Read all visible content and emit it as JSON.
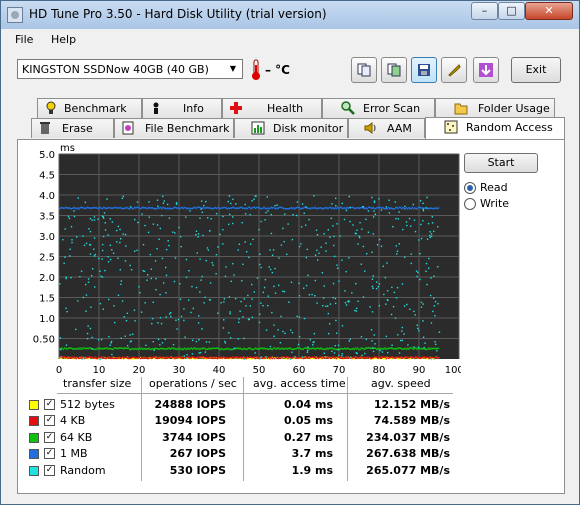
{
  "window": {
    "title": "HD Tune Pro 3.50 - Hard Disk Utility (trial version)",
    "controls": {
      "minimize": "–",
      "maximize": "□",
      "close": "✕"
    }
  },
  "menu": {
    "file": "File",
    "help": "Help"
  },
  "toolbar": {
    "drive_select": "KINGSTON SSDNow 40GB (40 GB)",
    "temperature": "– °C",
    "exit_label": "Exit"
  },
  "tabs_row1": [
    {
      "label": "Benchmark",
      "icon": "benchmark-icon"
    },
    {
      "label": "Info",
      "icon": "info-icon"
    },
    {
      "label": "Health",
      "icon": "health-icon"
    },
    {
      "label": "Error Scan",
      "icon": "search-icon"
    },
    {
      "label": "Folder Usage",
      "icon": "folder-icon"
    }
  ],
  "tabs_row2": [
    {
      "label": "Erase",
      "icon": "trash-icon"
    },
    {
      "label": "File Benchmark",
      "icon": "file-benchmark-icon"
    },
    {
      "label": "Disk monitor",
      "icon": "monitor-icon"
    },
    {
      "label": "AAM",
      "icon": "speaker-icon"
    },
    {
      "label": "Random Access",
      "icon": "random-access-icon"
    }
  ],
  "controls": {
    "start_label": "Start",
    "read_label": "Read",
    "write_label": "Write",
    "selected": "Read"
  },
  "table": {
    "headers": [
      "transfer size",
      "operations / sec",
      "avg. access time",
      "agv. speed"
    ],
    "rows": [
      {
        "label": "512 bytes",
        "color": "#ffff00",
        "checked": true,
        "ops": "24888 IOPS",
        "access": "0.04 ms",
        "speed": "12.152 MB/s"
      },
      {
        "label": "4 KB",
        "color": "#e01010",
        "checked": true,
        "ops": "19094 IOPS",
        "access": "0.05 ms",
        "speed": "74.589 MB/s"
      },
      {
        "label": "64 KB",
        "color": "#10c010",
        "checked": true,
        "ops": "3744 IOPS",
        "access": "0.27 ms",
        "speed": "234.037 MB/s"
      },
      {
        "label": "1 MB",
        "color": "#2070e0",
        "checked": true,
        "ops": "267 IOPS",
        "access": "3.7 ms",
        "speed": "267.638 MB/s"
      },
      {
        "label": "Random",
        "color": "#20e0e0",
        "checked": true,
        "ops": "530 IOPS",
        "access": "1.9 ms",
        "speed": "265.077 MB/s"
      }
    ]
  },
  "chart_data": {
    "type": "scatter",
    "ylabel": "ms",
    "xlabel": "",
    "ylim": [
      0,
      5.0
    ],
    "xlim": [
      0,
      100
    ],
    "y_ticks": [
      "5.0",
      "4.5",
      "4.0",
      "3.5",
      "3.0",
      "2.5",
      "2.0",
      "1.5",
      "1.0",
      "0.50"
    ],
    "x_ticks": [
      "0",
      "10",
      "20",
      "30",
      "40",
      "50",
      "60",
      "70",
      "80",
      "90",
      "100%"
    ],
    "grid": true,
    "series": [
      {
        "name": "512 bytes",
        "color": "#ffff00",
        "mean_y": 0.04
      },
      {
        "name": "4 KB",
        "color": "#e01010",
        "mean_y": 0.05
      },
      {
        "name": "64 KB",
        "color": "#10c010",
        "mean_y": 0.27
      },
      {
        "name": "1 MB",
        "color": "#2070e0",
        "mean_y": 3.7
      },
      {
        "name": "Random",
        "color": "#20e0e0",
        "mean_y": 1.9,
        "range_y": [
          0,
          4.0
        ]
      }
    ]
  }
}
